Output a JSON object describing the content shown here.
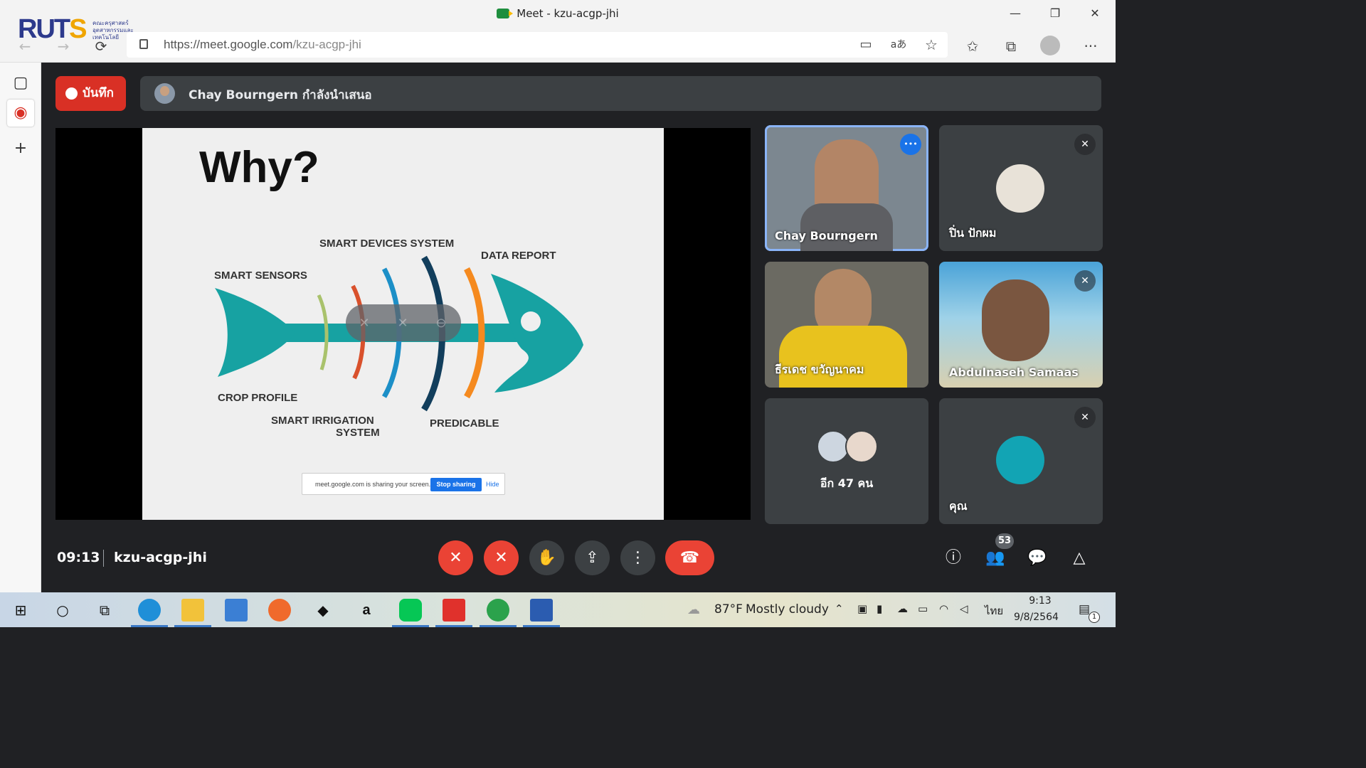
{
  "window": {
    "title": "Meet - kzu-acgp-jhi",
    "minimize": "—",
    "restore": "❐",
    "close": "✕"
  },
  "brand": {
    "logo_text_a": "RUT",
    "logo_text_b": "S",
    "faculty": "คณะครุศาสตร์อุตสาหกรรมและเทคโนโลยี"
  },
  "browser": {
    "back": "←",
    "forward": "→",
    "reload": "⟳",
    "url_prefix": "https://meet.google.com",
    "url_path": "/kzu-acgp-jhi",
    "camera_icon": "▭",
    "read_aloud": "aあ",
    "add_fav": "☆",
    "favorites": "✩",
    "collections": "⧉",
    "more": "···"
  },
  "sidebar": {
    "tabs_icon": "▢",
    "record_icon": "◉",
    "add_icon": "+"
  },
  "meet": {
    "record_label": "บันทึก",
    "presenter_label": "Chay Bourngern กำลังนำเสนอ",
    "slide": {
      "title": "Why?",
      "labels": {
        "smart_sensors": "SMART SENSORS",
        "smart_devices": "SMART DEVICES SYSTEM",
        "data_report": "DATA REPORT",
        "crop_profile": "CROP PROFILE",
        "smart_irrigation_1": "SMART IRRIGATION",
        "smart_irrigation_2": "SYSTEM",
        "predicable": "PREDICABLE"
      }
    },
    "share_banner": {
      "message": "meet.google.com is sharing your screen.",
      "stop": "Stop sharing",
      "hide": "Hide"
    },
    "overlay": {
      "pin": "✕",
      "mute": "✕",
      "remove": "⊖"
    },
    "tiles": [
      {
        "name": "Chay Bourngern",
        "more": "•••"
      },
      {
        "name": "ปิ่น ปักผม",
        "mute": "✕"
      },
      {
        "name": "ธีรเดช ขวัญนาคม"
      },
      {
        "name": "Abdulnaseh Samaas",
        "mute": "✕"
      },
      {
        "name": "อีก 47 คน"
      },
      {
        "name": "คุณ",
        "mute": "✕"
      }
    ],
    "bottom": {
      "time": "09:13",
      "code": "kzu-acgp-jhi",
      "mic": "✕",
      "cam": "✕",
      "hand": "✋",
      "present": "⇪",
      "more": "⋮",
      "end": "☎",
      "info": "ⓘ",
      "people": "👥",
      "people_count": "53",
      "chat": "💬",
      "activities": "△"
    }
  },
  "taskbar": {
    "start": "⊞",
    "search": "○",
    "taskview": "⧉",
    "weather_temp": "87°F",
    "weather_text": "Mostly cloudy",
    "lang": "ไทย",
    "time": "9:13",
    "date": "9/8/2564",
    "notif_count": "1"
  }
}
